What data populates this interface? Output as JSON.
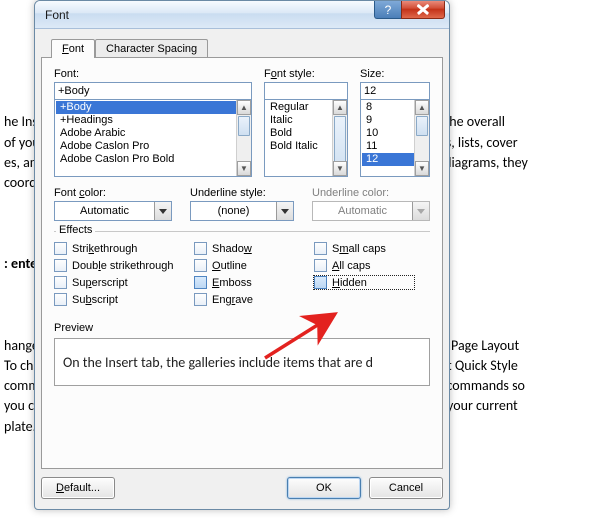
{
  "doc": {
    "lines": "he Insert tab, the galleries include items that are designed to coordinate with the overall\nof your document. You can use these galleries to insert tables, headers, footers, lists, cover\nes, and other document building blocks. When you create pictures, charts, or diagrams, they\ncoordinate with your current document look.",
    "bold_line": "enter the hidden text here:",
    "para2": "hange the overall look of your document, choose new Theme elements on the Page Layout\nTo change the looks available in the Quick Style gallery, use the Change Current Quick Style\ncommand. Both the Themes gallery and the Quick Styles gallery provide reset commands so\nyou can always restore the look of your document to the original contained in your current\nplate."
  },
  "dialog": {
    "title": "Font",
    "tabs": {
      "font": "Font",
      "spacing": "Character Spacing"
    },
    "labels": {
      "font": "Font:",
      "style": "Font style:",
      "size": "Size:",
      "color": "Font color:",
      "uline": "Underline style:",
      "ucolor": "Underline color:",
      "effects": "Effects",
      "preview": "Preview"
    },
    "font": {
      "value": "+Body",
      "list": [
        "+Body",
        "+Headings",
        "Adobe Arabic",
        "Adobe Caslon Pro",
        "Adobe Caslon Pro Bold"
      ]
    },
    "style": {
      "value": "",
      "list": [
        "Regular",
        "Italic",
        "Bold",
        "Bold Italic"
      ]
    },
    "size": {
      "value": "12",
      "list": [
        "8",
        "9",
        "10",
        "11",
        "12"
      ]
    },
    "color": {
      "value": "Automatic"
    },
    "uline": {
      "value": "(none)"
    },
    "ucolor": {
      "value": "Automatic"
    },
    "effects": {
      "strike": "Strikethrough",
      "dstrike": "Double strikethrough",
      "super": "Superscript",
      "sub": "Subscript",
      "shadow": "Shadow",
      "outline": "Outline",
      "emboss": "Emboss",
      "engrave": "Engrave",
      "smallcaps": "Small caps",
      "allcaps": "All caps",
      "hidden": "Hidden"
    },
    "preview_text": "On the Insert tab, the galleries include items that are d",
    "buttons": {
      "default": "Default...",
      "ok": "OK",
      "cancel": "Cancel"
    }
  }
}
